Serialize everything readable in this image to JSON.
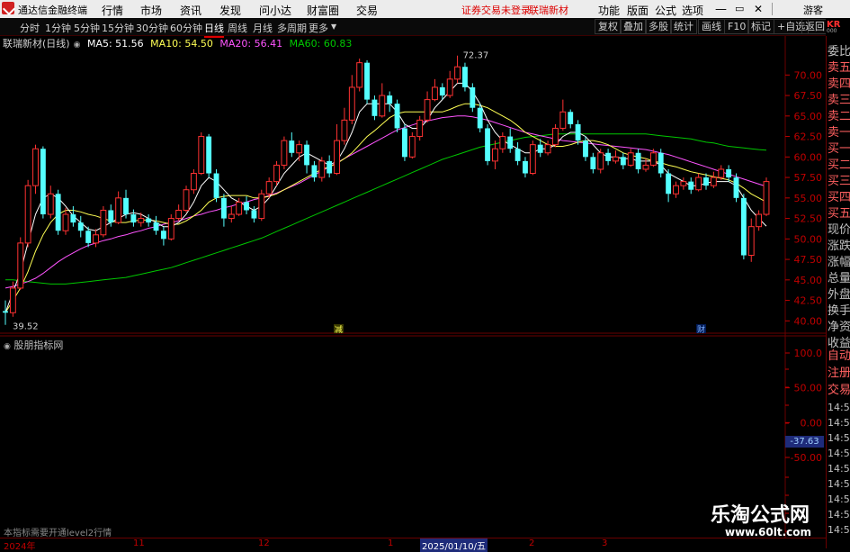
{
  "titlebar": {
    "app_name": "通达信金融终端",
    "menus": [
      "行情",
      "市场",
      "资讯",
      "发现",
      "问小达",
      "财富圈",
      "交易"
    ],
    "status": "证券交易未登录",
    "stock_name": "联瑞新材",
    "right_items": [
      "功能",
      "版面",
      "公式",
      "选项"
    ],
    "guest": "游客"
  },
  "toolbar": {
    "timeframes": [
      "分时",
      "1分钟",
      "5分钟",
      "15分钟",
      "30分钟",
      "60分钟",
      "日线",
      "周线",
      "月线",
      "多周期",
      "更多"
    ],
    "active": "日线",
    "buttons": [
      "复权",
      "叠加",
      "多股",
      "统计",
      "画线",
      "F10",
      "标记",
      "+自选",
      "返回"
    ]
  },
  "kr": {
    "code": "KR",
    "sub": "000"
  },
  "info": {
    "stock": "联瑞新材(日线)",
    "ma5": "MA5: 51.56",
    "ma10": "MA10: 54.50",
    "ma20": "MA20: 56.41",
    "ma60": "MA60: 60.83"
  },
  "price_axis": [
    "70.00",
    "67.50",
    "65.00",
    "62.50",
    "60.00",
    "57.50",
    "55.00",
    "52.50",
    "50.00",
    "47.50",
    "45.00",
    "42.50",
    "40.00"
  ],
  "indicator_axis": [
    "100.0",
    "50.00",
    "0.00",
    "-50.00"
  ],
  "indicator_current": "-37.63",
  "indicator_title": "股朋指标网",
  "level2_note": "本指标需要开通level2行情",
  "annotations": {
    "high": "72.37",
    "low": "39.52",
    "marker1": "减",
    "marker2": "财"
  },
  "date_axis": [
    "2024年",
    "11",
    "12",
    "1",
    "2025/01/10/五",
    "2",
    "3"
  ],
  "right_panel": {
    "labels": [
      "委比",
      "卖五",
      "卖四",
      "卖三",
      "卖二",
      "卖一",
      "买一",
      "买二",
      "买三",
      "买四",
      "买五",
      "现价",
      "涨跌",
      "涨幅",
      "总量",
      "外盘",
      "换手",
      "净资",
      "收益"
    ],
    "lower_labels": [
      "自动",
      "注册",
      "交易"
    ],
    "times": [
      "14:5",
      "14:5",
      "14:5",
      "14:5",
      "14:5",
      "14:5",
      "14:5",
      "14:5",
      "14:5"
    ]
  },
  "watermark": {
    "title": "乐淘公式网",
    "url": "www.60lt.com"
  },
  "colors": {
    "up": "#ff3232",
    "down": "#54ffff",
    "ma5": "#ffffff",
    "ma10": "#ffff54",
    "ma20": "#ff54ff",
    "ma60": "#00c800",
    "axis": "#c00000",
    "grid": "#6a0000"
  },
  "chart_data": {
    "type": "candlestick",
    "ylim": [
      38.5,
      73
    ],
    "candles": [
      [
        41.2,
        41.0,
        42.5,
        39.52
      ],
      [
        41.0,
        44.0,
        44.8,
        40.5
      ],
      [
        44.0,
        49.5,
        50.2,
        43.8
      ],
      [
        49.5,
        56.5,
        57.2,
        49.0
      ],
      [
        56.5,
        61.0,
        61.5,
        55.5
      ],
      [
        61.0,
        53.0,
        61.3,
        52.5
      ],
      [
        53.0,
        55.5,
        56.5,
        52.5
      ],
      [
        55.5,
        51.0,
        56.0,
        50.5
      ],
      [
        51.0,
        53.0,
        53.8,
        50.5
      ],
      [
        53.0,
        52.0,
        54.0,
        51.5
      ],
      [
        52.0,
        51.0,
        52.8,
        50.2
      ],
      [
        51.0,
        49.5,
        51.5,
        49.0
      ],
      [
        49.5,
        50.5,
        51.2,
        49.0
      ],
      [
        50.5,
        53.5,
        54.0,
        50.2
      ],
      [
        53.5,
        52.0,
        54.2,
        51.5
      ],
      [
        52.0,
        55.0,
        55.8,
        51.8
      ],
      [
        55.0,
        53.0,
        56.0,
        52.5
      ],
      [
        53.0,
        52.0,
        53.6,
        51.5
      ],
      [
        52.0,
        52.5,
        53.2,
        51.5
      ],
      [
        52.5,
        52.0,
        53.0,
        51.5
      ],
      [
        52.0,
        51.0,
        52.8,
        50.5
      ],
      [
        51.0,
        50.0,
        51.5,
        49.2
      ],
      [
        50.0,
        52.5,
        53.0,
        49.8
      ],
      [
        52.5,
        53.5,
        54.2,
        52.2
      ],
      [
        53.5,
        56.0,
        56.5,
        53.2
      ],
      [
        56.0,
        58.0,
        58.5,
        55.5
      ],
      [
        58.0,
        62.5,
        63.0,
        57.8
      ],
      [
        62.5,
        58.0,
        62.8,
        57.5
      ],
      [
        58.0,
        55.0,
        58.5,
        54.5
      ],
      [
        55.0,
        52.5,
        55.5,
        51.5
      ],
      [
        52.5,
        53.0,
        54.0,
        52.0
      ],
      [
        53.0,
        54.5,
        55.0,
        52.8
      ],
      [
        54.5,
        53.5,
        55.2,
        53.0
      ],
      [
        53.5,
        52.5,
        54.0,
        52.0
      ],
      [
        52.5,
        55.5,
        56.0,
        52.2
      ],
      [
        55.5,
        57.0,
        57.5,
        55.0
      ],
      [
        57.0,
        59.0,
        59.5,
        56.5
      ],
      [
        59.0,
        62.0,
        62.5,
        58.5
      ],
      [
        62.0,
        60.5,
        63.0,
        60.0
      ],
      [
        60.5,
        61.5,
        62.0,
        59.5
      ],
      [
        61.5,
        59.0,
        62.0,
        58.0
      ],
      [
        59.0,
        57.5,
        59.5,
        57.0
      ],
      [
        57.5,
        59.5,
        60.0,
        57.0
      ],
      [
        59.5,
        58.0,
        60.2,
        57.5
      ],
      [
        58.0,
        62.0,
        64.0,
        57.8
      ],
      [
        62.0,
        64.5,
        66.0,
        61.5
      ],
      [
        64.5,
        68.5,
        70.0,
        64.0
      ],
      [
        68.5,
        71.5,
        72.0,
        68.0
      ],
      [
        71.5,
        67.0,
        71.8,
        66.5
      ],
      [
        67.0,
        65.0,
        67.5,
        64.5
      ],
      [
        65.0,
        67.5,
        69.0,
        64.8
      ],
      [
        67.5,
        66.5,
        68.0,
        65.5
      ],
      [
        66.5,
        63.5,
        67.0,
        63.0
      ],
      [
        63.5,
        60.0,
        64.0,
        59.5
      ],
      [
        60.0,
        62.5,
        63.0,
        59.8
      ],
      [
        62.5,
        64.5,
        65.0,
        62.0
      ],
      [
        64.5,
        67.0,
        68.0,
        64.2
      ],
      [
        67.0,
        68.5,
        69.5,
        66.8
      ],
      [
        68.5,
        67.5,
        69.0,
        67.0
      ],
      [
        67.5,
        69.5,
        70.5,
        67.2
      ],
      [
        69.5,
        71.0,
        72.37,
        69.0
      ],
      [
        71.0,
        68.5,
        71.5,
        68.0
      ],
      [
        68.5,
        66.0,
        69.0,
        65.5
      ],
      [
        66.0,
        63.5,
        66.5,
        63.0
      ],
      [
        63.5,
        59.5,
        64.0,
        59.0
      ],
      [
        59.5,
        61.0,
        62.0,
        58.5
      ],
      [
        61.0,
        62.5,
        63.0,
        60.5
      ],
      [
        62.5,
        61.0,
        63.5,
        60.5
      ],
      [
        61.0,
        59.5,
        61.8,
        59.0
      ],
      [
        59.5,
        58.0,
        60.0,
        57.5
      ],
      [
        58.0,
        61.5,
        62.0,
        57.8
      ],
      [
        61.5,
        60.5,
        62.2,
        60.0
      ],
      [
        60.5,
        61.5,
        62.0,
        60.2
      ],
      [
        61.5,
        63.5,
        64.0,
        61.2
      ],
      [
        63.5,
        65.5,
        67.0,
        63.2
      ],
      [
        65.5,
        64.0,
        65.8,
        63.5
      ],
      [
        64.0,
        62.0,
        64.5,
        61.5
      ],
      [
        62.0,
        60.0,
        62.5,
        59.5
      ],
      [
        60.0,
        58.5,
        60.5,
        58.0
      ],
      [
        58.5,
        60.5,
        61.0,
        58.0
      ],
      [
        60.5,
        59.5,
        61.0,
        59.0
      ],
      [
        59.5,
        60.0,
        60.8,
        59.2
      ],
      [
        60.0,
        59.0,
        60.5,
        58.5
      ],
      [
        59.0,
        60.5,
        61.0,
        58.8
      ],
      [
        60.5,
        58.5,
        61.0,
        58.0
      ],
      [
        58.5,
        59.0,
        59.8,
        58.2
      ],
      [
        59.0,
        60.5,
        61.0,
        58.8
      ],
      [
        60.5,
        58.0,
        61.0,
        57.5
      ],
      [
        58.0,
        55.5,
        58.5,
        54.5
      ],
      [
        55.5,
        56.5,
        57.0,
        55.0
      ],
      [
        56.5,
        57.0,
        57.5,
        56.0
      ],
      [
        57.0,
        56.0,
        57.5,
        55.5
      ],
      [
        56.0,
        57.5,
        58.0,
        55.8
      ],
      [
        57.5,
        56.5,
        58.0,
        56.0
      ],
      [
        56.5,
        57.5,
        58.2,
        56.2
      ],
      [
        57.5,
        58.5,
        59.0,
        57.2
      ],
      [
        58.5,
        57.5,
        59.0,
        57.0
      ],
      [
        57.5,
        55.0,
        58.0,
        54.5
      ],
      [
        55.0,
        48.0,
        55.5,
        47.5
      ],
      [
        48.0,
        51.5,
        52.5,
        47.2
      ],
      [
        51.5,
        53.0,
        53.5,
        51.0
      ],
      [
        53.0,
        57.0,
        57.5,
        52.8
      ]
    ],
    "ma5": [
      41.0,
      43.5,
      46.0,
      49.5,
      53.0,
      55.0,
      55.5,
      55.0,
      54.0,
      52.8,
      52.0,
      51.2,
      51.0,
      51.5,
      52.0,
      52.5,
      53.0,
      53.2,
      53.0,
      52.5,
      52.0,
      51.5,
      51.5,
      52.0,
      53.0,
      54.5,
      56.5,
      57.5,
      57.0,
      56.0,
      55.0,
      54.5,
      54.0,
      53.5,
      54.0,
      55.0,
      56.5,
      58.0,
      59.0,
      60.0,
      60.5,
      60.0,
      59.5,
      59.0,
      59.5,
      61.0,
      63.0,
      65.5,
      66.5,
      66.5,
      66.5,
      66.5,
      65.5,
      64.0,
      63.5,
      63.5,
      64.5,
      66.0,
      67.0,
      68.0,
      69.0,
      69.0,
      68.0,
      66.5,
      64.5,
      63.0,
      62.0,
      61.5,
      61.0,
      60.5,
      60.5,
      61.0,
      61.0,
      61.5,
      62.5,
      63.0,
      63.0,
      62.5,
      61.5,
      60.5,
      60.0,
      60.0,
      59.8,
      59.8,
      59.5,
      59.5,
      59.5,
      59.0,
      58.0,
      57.5,
      57.0,
      56.5,
      56.5,
      56.8,
      57.0,
      57.0,
      57.0,
      56.5,
      55.0,
      53.5,
      52.5,
      51.56
    ],
    "ma10": [
      41.0,
      42.5,
      44.0,
      46.0,
      48.5,
      50.5,
      52.0,
      53.0,
      53.5,
      53.5,
      53.3,
      53.0,
      52.8,
      52.5,
      52.2,
      52.0,
      52.0,
      52.2,
      52.3,
      52.3,
      52.2,
      52.0,
      51.8,
      51.8,
      52.2,
      52.8,
      53.5,
      54.5,
      55.0,
      55.2,
      55.3,
      55.3,
      55.3,
      55.0,
      55.0,
      55.2,
      55.5,
      56.0,
      56.5,
      57.0,
      57.5,
      58.0,
      58.5,
      58.8,
      59.2,
      59.8,
      60.5,
      61.5,
      62.5,
      63.2,
      64.0,
      64.8,
      65.3,
      65.5,
      65.5,
      65.5,
      65.5,
      65.5,
      65.5,
      65.8,
      66.2,
      66.5,
      66.5,
      66.3,
      66.0,
      65.5,
      65.0,
      64.5,
      63.8,
      63.0,
      62.5,
      62.0,
      61.5,
      61.3,
      61.3,
      61.5,
      61.8,
      62.0,
      62.0,
      61.8,
      61.5,
      61.0,
      60.5,
      60.2,
      60.0,
      59.8,
      59.5,
      59.3,
      59.0,
      58.8,
      58.5,
      58.2,
      58.0,
      57.8,
      57.6,
      57.4,
      57.2,
      56.8,
      56.2,
      55.5,
      55.0,
      54.5
    ],
    "ma20": [
      44.0,
      44.2,
      44.5,
      44.8,
      45.2,
      45.8,
      46.5,
      47.2,
      47.8,
      48.3,
      48.8,
      49.2,
      49.5,
      49.8,
      50.0,
      50.3,
      50.5,
      50.8,
      51.0,
      51.3,
      51.5,
      51.8,
      52.0,
      52.2,
      52.5,
      52.8,
      53.0,
      53.3,
      53.5,
      53.8,
      54.0,
      54.3,
      54.5,
      54.8,
      55.0,
      55.3,
      55.6,
      56.0,
      56.4,
      56.8,
      57.3,
      57.8,
      58.3,
      58.8,
      59.3,
      59.8,
      60.3,
      60.8,
      61.3,
      61.8,
      62.3,
      62.8,
      63.3,
      63.6,
      63.9,
      64.2,
      64.4,
      64.6,
      64.8,
      64.9,
      65.0,
      65.0,
      64.9,
      64.7,
      64.5,
      64.2,
      63.9,
      63.6,
      63.3,
      63.0,
      62.8,
      62.6,
      62.4,
      62.2,
      62.0,
      61.9,
      61.8,
      61.7,
      61.6,
      61.5,
      61.4,
      61.3,
      61.2,
      61.1,
      61.0,
      60.9,
      60.7,
      60.5,
      60.3,
      60.0,
      59.7,
      59.4,
      59.1,
      58.8,
      58.5,
      58.2,
      57.9,
      57.6,
      57.3,
      57.0,
      56.7,
      56.41
    ],
    "ma60": [
      45.0,
      45.0,
      44.9,
      44.8,
      44.7,
      44.6,
      44.5,
      44.5,
      44.5,
      44.6,
      44.7,
      44.8,
      44.9,
      45.0,
      45.1,
      45.2,
      45.3,
      45.5,
      45.7,
      45.9,
      46.1,
      46.3,
      46.5,
      46.8,
      47.1,
      47.4,
      47.7,
      48.0,
      48.3,
      48.6,
      48.9,
      49.2,
      49.5,
      49.8,
      50.1,
      50.5,
      50.9,
      51.3,
      51.7,
      52.1,
      52.5,
      52.9,
      53.3,
      53.7,
      54.1,
      54.5,
      54.9,
      55.3,
      55.7,
      56.1,
      56.5,
      56.9,
      57.3,
      57.7,
      58.1,
      58.5,
      58.9,
      59.3,
      59.7,
      60.0,
      60.3,
      60.6,
      60.9,
      61.2,
      61.4,
      61.6,
      61.8,
      62.0,
      62.2,
      62.4,
      62.5,
      62.6,
      62.7,
      62.8,
      62.8,
      62.8,
      62.8,
      62.8,
      62.8,
      62.8,
      62.8,
      62.8,
      62.8,
      62.8,
      62.8,
      62.8,
      62.7,
      62.6,
      62.5,
      62.4,
      62.3,
      62.2,
      62.0,
      61.8,
      61.7,
      61.5,
      61.3,
      61.2,
      61.1,
      61.0,
      60.9,
      60.83
    ]
  }
}
